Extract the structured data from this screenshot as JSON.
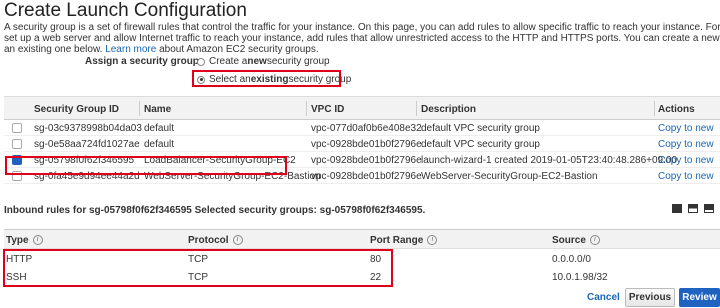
{
  "page": {
    "title": "Create Launch Configuration",
    "description_lines": [
      "A security group is a set of firewall rules that control the traffic for your instance. On this page, you can add rules to allow specific traffic to reach your instance. For example, if you want t",
      "set up a web server and allow Internet traffic to reach your instance, add rules that allow unrestricted access to the HTTP and HTTPS ports. You can create a new security group or selec",
      "an existing one below."
    ],
    "learn_more": "Learn more",
    "learn_more_suffix": " about Amazon EC2 security groups."
  },
  "assign": {
    "label": "Assign a security group:",
    "option_create_pre": "Create a ",
    "option_create_bold": "new",
    "option_create_post": " security group",
    "option_select_pre": "Select an ",
    "option_select_bold": "existing",
    "option_select_post": " security group",
    "selected": "existing"
  },
  "sg_table": {
    "headers": {
      "id": "Security Group ID",
      "name": "Name",
      "vpc": "VPC ID",
      "desc": "Description",
      "actions": "Actions"
    },
    "rows": [
      {
        "id": "sg-03c9378998b04da03",
        "name": "default",
        "vpc": "vpc-077d0af0b6e408e32",
        "desc": "default VPC security group",
        "action": "Copy to new",
        "checked": false
      },
      {
        "id": "sg-0e58aa724fd1027ae",
        "name": "default",
        "vpc": "vpc-0928bde01b0f2796e",
        "desc": "default VPC security group",
        "action": "Copy to new",
        "checked": false
      },
      {
        "id": "sg-05798f0f62f346595",
        "name": "LoadBalancer-SecurityGroup-EC2",
        "vpc": "vpc-0928bde01b0f2796e",
        "desc": "launch-wizard-1 created 2019-01-05T23:40:48.286+09:00",
        "action": "Copy to new",
        "checked": true
      },
      {
        "id": "sg-0fa45e9d94ee44a2d",
        "name": "WebServer-SecurityGroup-EC2-Bastion",
        "vpc": "vpc-0928bde01b0f2796e",
        "desc": "WebServer-SecurityGroup-EC2-Bastion",
        "action": "Copy to new",
        "checked": false
      }
    ]
  },
  "inbound": {
    "title": "Inbound rules for sg-05798f0f62f346595 Selected security groups: sg-05798f0f62f346595."
  },
  "rules_table": {
    "headers": {
      "type": "Type",
      "protocol": "Protocol",
      "port": "Port Range",
      "source": "Source"
    },
    "rows": [
      {
        "type": "HTTP",
        "protocol": "TCP",
        "port": "80",
        "source": "0.0.0.0/0"
      },
      {
        "type": "SSH",
        "protocol": "TCP",
        "port": "22",
        "source": "10.0.1.98/32"
      }
    ]
  },
  "footer": {
    "cancel": "Cancel",
    "previous": "Previous",
    "review": "Review"
  },
  "colors": {
    "accent": "#1f62c0",
    "highlight": "#e0001b",
    "link": "#1a66b3"
  }
}
